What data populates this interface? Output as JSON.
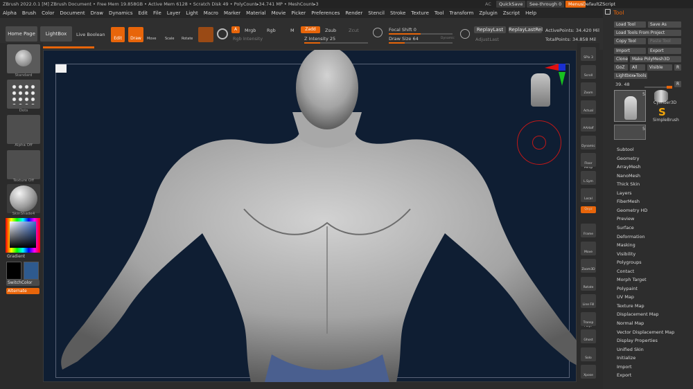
{
  "titlebar": {
    "text": "ZBrush 2022.0.1 [M]  ZBrush Document  • Free Mem 19.858GB • Active Mem 6128 • Scratch Disk 49 • PolyCount▸34.741 MP • MeshCount▸3",
    "ac": "AC",
    "quicksave": "QuickSave",
    "seethrough": "See-through",
    "seethrough_value": "0",
    "menus": "Menus",
    "defaultzscript": "DefaultZScript"
  },
  "menubar": [
    "Alpha",
    "Brush",
    "Color",
    "Document",
    "Draw",
    "Dynamics",
    "Edit",
    "File",
    "Layer",
    "Light",
    "Macro",
    "Marker",
    "Material",
    "Movie",
    "Picker",
    "Preferences",
    "Render",
    "Stencil",
    "Stroke",
    "Texture",
    "Tool",
    "Transform",
    "Zplugin",
    "Zscript",
    "Help"
  ],
  "toolbar": {
    "home_page": "Home Page",
    "lightbox": "LightBox",
    "live_boolean": "Live Boolean",
    "edit": "Edit",
    "draw": "Draw",
    "move": "Move",
    "scale": "Scale",
    "rotate": "Rotate",
    "a": "A",
    "mrgb": "Mrgb",
    "rgb": "Rgb",
    "m": "M",
    "zadd": "Zadd",
    "zsub": "Zsub",
    "zcut": "Zcut",
    "rgb_intensity": "Rgb Intensity",
    "z_intensity": "Z Intensity",
    "z_intensity_value": "25",
    "focal_shift": "Focal Shift",
    "focal_shift_value": "0",
    "draw_size": "Draw Size",
    "draw_size_value": "64",
    "dynamic": "Dynamic",
    "replay_last": "ReplayLast",
    "replay_last_rel": "ReplayLastRel",
    "active_points": "ActivePoints: 34.420 Mil",
    "total_points": "TotalPoints: 34.858 Mil",
    "adjust_last": "AdjustLast"
  },
  "leftpanel": {
    "brush": "Standard",
    "stroke": "Dots",
    "alpha": "Alpha Off",
    "texture": "Texture Off",
    "material": "SkinShade4",
    "gradient": "Gradient",
    "switch_color": "SwitchColor",
    "alternate": "Alternate"
  },
  "rightstrip": [
    "SPix 3",
    "Scroll",
    "Zoom",
    "Actual",
    "AAHalf",
    "Dynamic Persp",
    "Floor",
    "L.Sym",
    "Local",
    "Qxyz",
    "Frame",
    "Move",
    "Zoom3D",
    "Rotate",
    "Line Fill PolyF",
    "Transp",
    "Ghost",
    "Solo",
    "Xpose"
  ],
  "toolpanel": {
    "title": "Tool",
    "load_tool": "Load Tool",
    "save_as": "Save As",
    "load_from_project": "Load Tools From Project",
    "copy_tool": "Copy Tool",
    "paste_tool": "Paste Tool",
    "import": "Import",
    "export": "Export",
    "clone": "Clone",
    "make_polymesh": "Make PolyMesh3D",
    "goz": "GoZ",
    "all": "All",
    "visible": "Visible",
    "r": "R",
    "lightbox_tools": "Lightbox▸Tools",
    "tool_value": "39. 48",
    "thumb_count_1": "5",
    "thumb_count_2": "5",
    "cylinder": "Cylinder3D",
    "simplebrush": "SimpleBrush",
    "items": [
      "Subtool",
      "Geometry",
      "ArrayMesh",
      "NanoMesh",
      "Thick Skin",
      "Layers",
      "FiberMesh",
      "Geometry HD",
      "Preview",
      "Surface",
      "Deformation",
      "Masking",
      "Visibility",
      "Polygroups",
      "Contact",
      "Morph Target",
      "Polypaint",
      "UV Map",
      "Texture Map",
      "Displacement Map",
      "Normal Map",
      "Vector Displacement Map",
      "Display Properties",
      "Unified Skin",
      "Initialize",
      "Import",
      "Export"
    ]
  },
  "colors": {
    "accent": "#e8650a",
    "canvas": "#0f1e33",
    "secondary_color": "#2e5a8e"
  }
}
